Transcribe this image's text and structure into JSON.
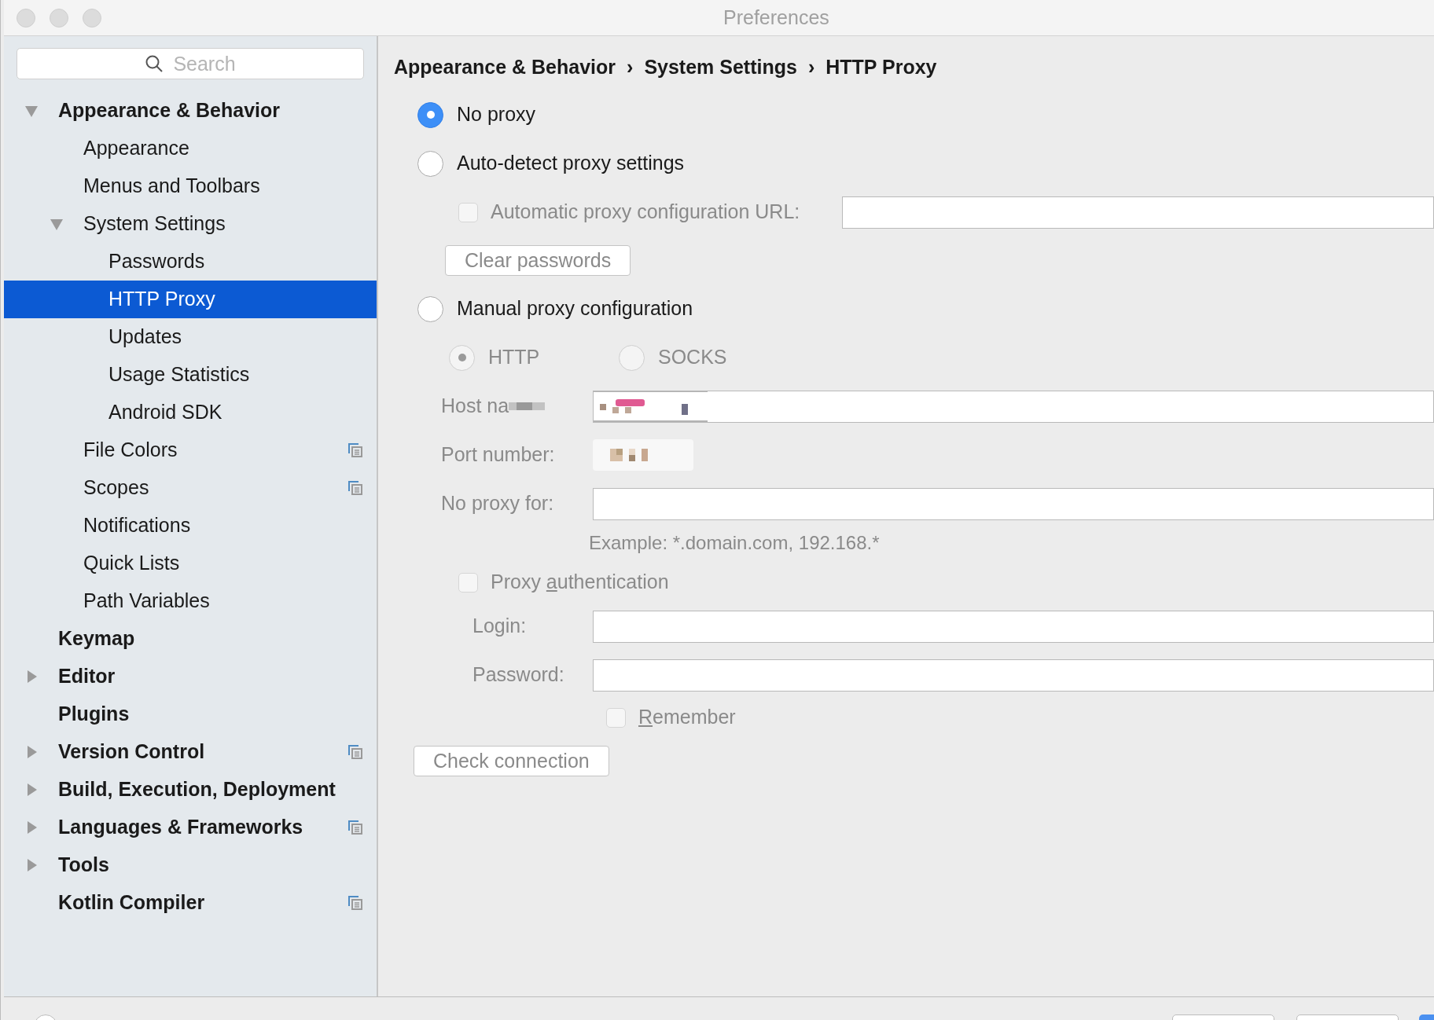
{
  "window": {
    "title": "Preferences"
  },
  "search": {
    "placeholder": "Search"
  },
  "tree": [
    {
      "label": "Appearance & Behavior",
      "expanded": true,
      "children": [
        {
          "label": "Appearance"
        },
        {
          "label": "Menus and Toolbars"
        },
        {
          "label": "System Settings",
          "expanded": true,
          "children": [
            {
              "label": "Passwords",
              "selected": false
            },
            {
              "label": "HTTP Proxy",
              "selected": true
            },
            {
              "label": "Updates",
              "selected": false
            },
            {
              "label": "Usage Statistics",
              "selected": false
            },
            {
              "label": "Android SDK",
              "selected": false
            }
          ]
        },
        {
          "label": "File Colors",
          "project_level": true
        },
        {
          "label": "Scopes",
          "project_level": true
        },
        {
          "label": "Notifications"
        },
        {
          "label": "Quick Lists"
        },
        {
          "label": "Path Variables"
        }
      ]
    },
    {
      "label": "Keymap"
    },
    {
      "label": "Editor",
      "expanded": false
    },
    {
      "label": "Plugins"
    },
    {
      "label": "Version Control",
      "expanded": false,
      "project_level": true
    },
    {
      "label": "Build, Execution, Deployment",
      "expanded": false
    },
    {
      "label": "Languages & Frameworks",
      "expanded": false,
      "project_level": true
    },
    {
      "label": "Tools",
      "expanded": false
    },
    {
      "label": "Kotlin Compiler",
      "project_level": true
    }
  ],
  "breadcrumb": {
    "items": [
      "Appearance & Behavior",
      "System Settings",
      "HTTP Proxy"
    ],
    "separators": [
      "›",
      "›"
    ]
  },
  "proxy_modes": [
    {
      "label": "No proxy",
      "selected": true
    },
    {
      "label": "Auto-detect proxy settings",
      "selected": false
    },
    {
      "label": "Manual proxy configuration",
      "selected": false
    }
  ],
  "auto_config": {
    "label": "Automatic proxy configuration URL:",
    "checked": false,
    "disabled": true
  },
  "clear_passwords": {
    "label": "Clear passwords"
  },
  "manual": {
    "disabled": true,
    "protocols": [
      {
        "label": "HTTP",
        "selected": true
      },
      {
        "label": "SOCKS",
        "selected": false
      }
    ],
    "host": {
      "label": "Host na"
    },
    "port": {
      "label": "Port number:"
    },
    "no_proxy": {
      "label": "No proxy for:",
      "hint": "Example: *.domain.com, 192.168.*"
    },
    "proxy_auth": {
      "label": [
        {
          "text": "Proxy ",
          "underline": false
        },
        {
          "text": "a",
          "underline": true
        },
        {
          "text": "uthentication",
          "underline": false
        }
      ],
      "checked": false
    },
    "login": {
      "label": "Login:"
    },
    "password": {
      "label": "Password:"
    },
    "remember": {
      "label": [
        {
          "text": "R",
          "underline": true
        },
        {
          "text": "emember",
          "underline": false
        }
      ],
      "checked": false
    }
  },
  "check_connection": {
    "label": "Check connection"
  }
}
